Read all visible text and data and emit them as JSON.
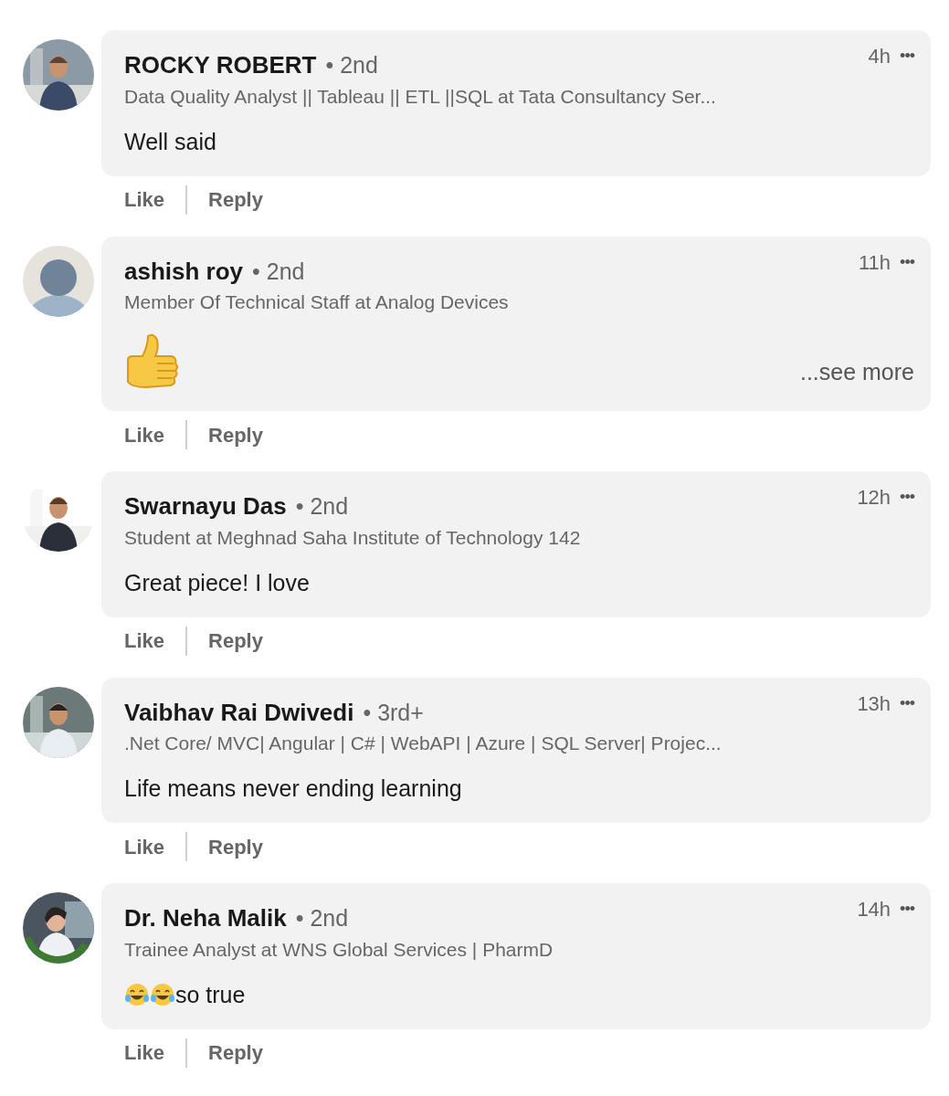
{
  "comments": [
    {
      "name": "ROCKY ROBERT",
      "degree": "• 2nd",
      "headline": "Data Quality Analyst || Tableau || ETL ||SQL at Tata Consultancy Ser...",
      "time": "4h",
      "menu": "•••",
      "text": "Well said",
      "like": "Like",
      "reply": "Reply"
    },
    {
      "avatar": {
        "kind": "placeholder"
      },
      "name": "ashish roy",
      "degree": "• 2nd",
      "headline": "Member Of Technical Staff at Analog Devices",
      "time": "11h",
      "menu": "•••",
      "emojis": [
        {
          "kind": "thumbs-up"
        }
      ],
      "see_more": "...see more",
      "like": "Like",
      "reply": "Reply"
    },
    {
      "name": "Swarnayu Das",
      "degree": "• 2nd",
      "headline": "Student at Meghnad Saha Institute of Technology 142",
      "time": "12h",
      "menu": "•••",
      "text": "Great piece! I love",
      "like": "Like",
      "reply": "Reply"
    },
    {
      "name": "Vaibhav Rai Dwivedi",
      "degree": "• 3rd+",
      "headline": ".Net Core/ MVC| Angular | C# | WebAPI | Azure | SQL Server| Projec...",
      "time": "13h",
      "menu": "•••",
      "text": "Life means never ending learning",
      "like": "Like",
      "reply": "Reply"
    },
    {
      "avatar": {
        "kind": "open-to-work"
      },
      "name": "Dr. Neha Malik",
      "degree": "• 2nd",
      "headline": "Trainee Analyst at WNS Global Services | PharmD",
      "time": "14h",
      "menu": "•••",
      "emojis": [
        {
          "kind": "laughing"
        },
        {
          "kind": "laughing"
        }
      ],
      "text": "so true",
      "like": "Like",
      "reply": "Reply"
    }
  ]
}
